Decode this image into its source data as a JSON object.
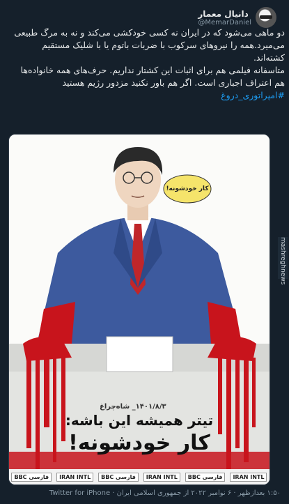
{
  "tweet": {
    "author_name": "دانیال معمار",
    "author_handle": "@MemarDaniel",
    "paragraph1": "دو ماهی می‌شود که در ایران نه کسی خودکشی می‌کند و نه به مرگ طبیعی می‌میرد.همه را نیروهای سرکوب با ضربات باتوم یا با شلیک مستقیم کشته‌اند.",
    "paragraph2": "متاسفانه فیلمی هم برای اثبات این کشتار نداریم. حرف‌های همه خانواده‌ها هم اعتراف اجباری است. اگر هم باور نکنید مزدور رژیم هستید",
    "hashtag": "#امپراتوری_دروغ",
    "footer_time": "۱:۵۰ بعدازظهر · ۶ نوامبر ۲۰۲۲ از جمهوری اسلامی ایران",
    "footer_source": "Twitter for iPhone"
  },
  "card": {
    "speech_bubble": "کار خودشونه!",
    "date_line": "۱۴۰۱/۸/۳_ شاه‌چراغ",
    "slogan_line1": "تیتر همیشه این باشه:",
    "slogan_line2": "کار خودشونه!",
    "logos": [
      "BBC فارسی",
      "IRAN INTL",
      "BBC فارسی",
      "IRAN INTL",
      "BBC فارسی",
      "IRAN INTL"
    ]
  },
  "watermark": "mashreghnews",
  "colors": {
    "background": "#15202b",
    "link": "#1d9bf0",
    "suit": "#3d5a9e",
    "blood": "#c8141c",
    "tie": "#c0262a"
  },
  "icons": {
    "avatar": "avatar-image",
    "watermark": "watermark-label"
  }
}
